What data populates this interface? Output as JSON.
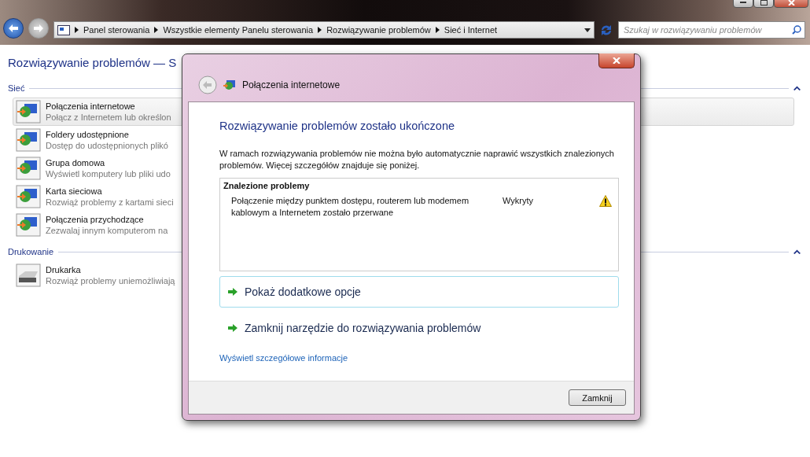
{
  "address_bar": {
    "breadcrumbs": [
      "Panel sterowania",
      "Wszystkie elementy Panelu sterowania",
      "Rozwiązywanie problemów",
      "Sieć i Internet"
    ],
    "back_disabled": false,
    "forward_disabled": true
  },
  "search": {
    "placeholder": "Szukaj w rozwiązywaniu problemów"
  },
  "page": {
    "title": "Rozwiązywanie problemów — S",
    "sections": [
      {
        "title": "Sieć",
        "expanded": true,
        "items": [
          {
            "name": "Połączenia internetowe",
            "description": "Połącz z Internetem lub określon",
            "selected": true
          },
          {
            "name": "Foldery udostępnione",
            "description": "Dostęp do udostępnionych plikó",
            "selected": false
          },
          {
            "name": "Grupa domowa",
            "description": "Wyświetl komputery lub pliki udo",
            "selected": false
          },
          {
            "name": "Karta sieciowa",
            "description": "Rozwiąż problemy z kartami sieci",
            "selected": false
          },
          {
            "name": "Połączenia przychodzące",
            "description": "Zezwalaj innym komputerom na",
            "selected": false
          }
        ]
      },
      {
        "title": "Drukowanie",
        "expanded": true,
        "items": [
          {
            "name": "Drukarka",
            "description": "Rozwiąż problemy uniemożliwiają",
            "selected": false
          }
        ]
      }
    ]
  },
  "dialog": {
    "title": "Połączenia internetowe",
    "heading": "Rozwiązywanie problemów zostało ukończone",
    "message": "W ramach rozwiązywania problemów nie można było automatycznie naprawić wszystkich znalezionych problemów. Więcej szczegółów znajduje się poniżej.",
    "problems": {
      "header": "Znalezione problemy",
      "rows": [
        {
          "problem": "Połączenie między punktem dostępu, routerem lub modemem kablowym a Internetem zostało przerwane",
          "status": "Wykryty",
          "warning": true
        }
      ]
    },
    "options": [
      {
        "label": "Pokaż dodatkowe opcje",
        "selected": true
      },
      {
        "label": "Zamknij narzędzie do rozwiązywania problemów",
        "selected": false
      }
    ],
    "details_link": "Wyświetl szczegółowe informacje",
    "close_button": "Zamknij"
  }
}
